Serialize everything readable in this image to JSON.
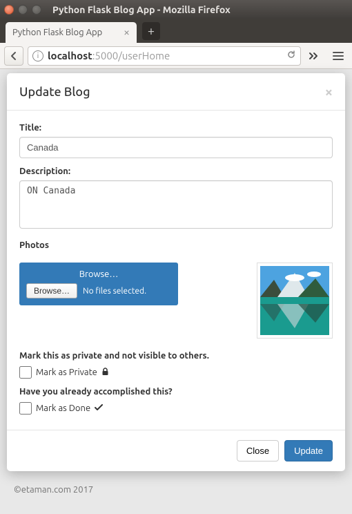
{
  "window": {
    "title": "Python Flask Blog App - Mozilla Firefox",
    "tab_label": "Python Flask Blog App"
  },
  "url": {
    "host_bold": "localhost",
    "host_rest": ":5000/userHome"
  },
  "modal": {
    "title": "Update Blog",
    "labels": {
      "title": "Title:",
      "description": "Description:",
      "photos": "Photos"
    },
    "values": {
      "title": "Canada",
      "description": "ON Canada"
    },
    "upload": {
      "browse_top": "Browse…",
      "browse_btn": "Browse…",
      "no_files": "No files selected."
    },
    "private_heading": "Mark this as private and not visible to others.",
    "private_label": "Mark as Private",
    "done_heading": "Have you already accomplished this?",
    "done_label": "Mark as Done",
    "buttons": {
      "close": "Close",
      "update": "Update"
    }
  },
  "footer": "©etaman.com 2017"
}
